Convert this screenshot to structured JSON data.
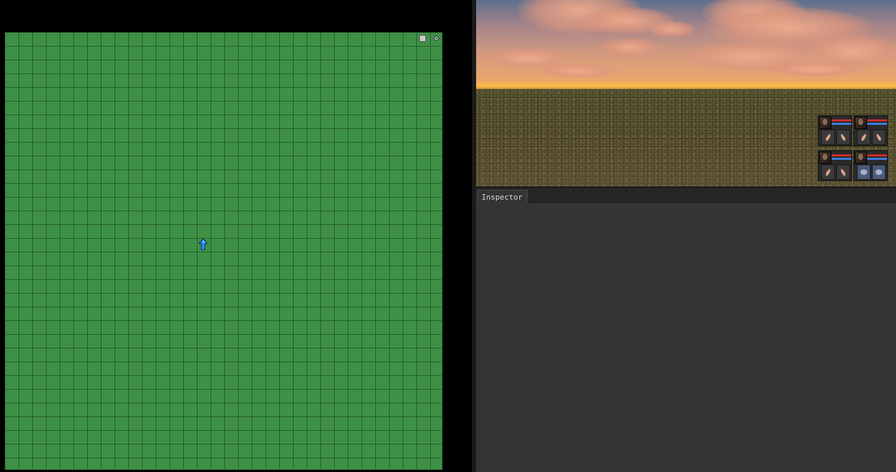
{
  "map": {
    "square_button_icon": "square-icon",
    "diamond_button_icon": "diamond-icon",
    "player_marker_icon": "up-arrow-icon",
    "grid_color": "#3d8f45",
    "player_color": "#2f8ef0"
  },
  "party": {
    "members": [
      {
        "hp": 1.0,
        "mp": 1.0,
        "left_hand": "hand-icon",
        "right_hand": "hand-icon"
      },
      {
        "hp": 1.0,
        "mp": 1.0,
        "left_hand": "hand-icon",
        "right_hand": "hand-icon"
      },
      {
        "hp": 1.0,
        "mp": 1.0,
        "left_hand": "hand-icon",
        "right_hand": "hand-icon"
      },
      {
        "hp": 1.0,
        "mp": 1.0,
        "left_hand": "magic-hand-icon",
        "right_hand": "magic-hand-icon"
      }
    ]
  },
  "inspector": {
    "tab_label": "Inspector"
  }
}
